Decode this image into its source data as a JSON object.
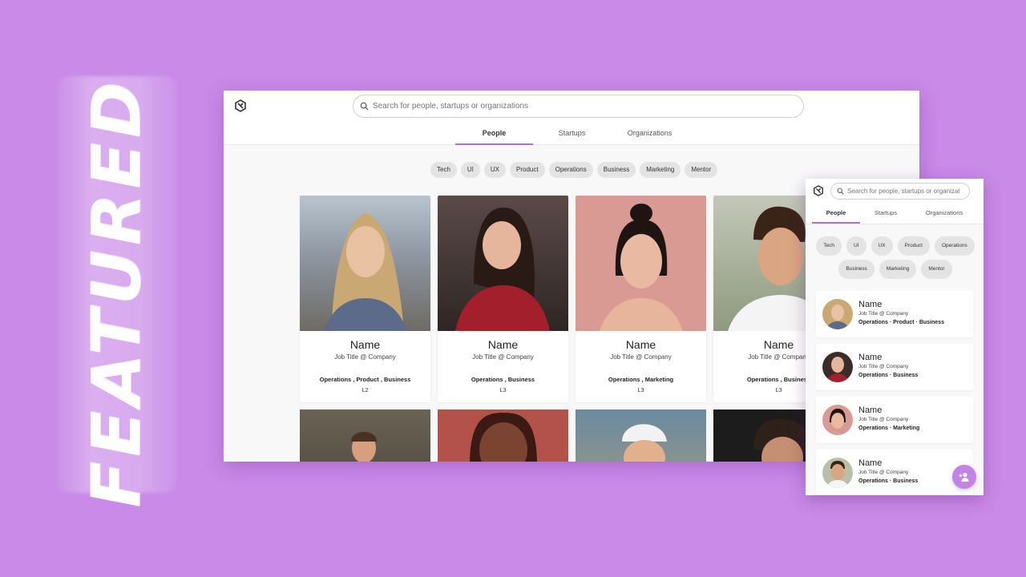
{
  "banner": {
    "text": "FEATURED"
  },
  "search": {
    "placeholder": "Search for people, startups or organizations"
  },
  "tabs": [
    {
      "label": "People",
      "active": true
    },
    {
      "label": "Startups",
      "active": false
    },
    {
      "label": "Organizations",
      "active": false
    }
  ],
  "filters": [
    "Tech",
    "UI",
    "UX",
    "Product",
    "Operations",
    "Business",
    "Marketing",
    "Mentor"
  ],
  "people": [
    {
      "name": "Name",
      "job": "Job Title @ Company",
      "tags": "Operations , Product , Business",
      "level": "L2",
      "mobile_tags": "Operations · Product · Business"
    },
    {
      "name": "Name",
      "job": "Job Title @ Company",
      "tags": "Operations , Business",
      "level": "L3",
      "mobile_tags": "Operations · Business"
    },
    {
      "name": "Name",
      "job": "Job Title @ Company",
      "tags": "Operations , Marketing",
      "level": "L3",
      "mobile_tags": "Operations · Marketing"
    },
    {
      "name": "Name",
      "job": "Job Title @ Company",
      "tags": "Operations , Business",
      "level": "L3",
      "mobile_tags": "Operations · Business"
    }
  ],
  "colors": {
    "background": "#c98ae8",
    "accent": "#b36fd9",
    "fab": "#c282e6"
  },
  "icons": {
    "logo": "app-logo-icon",
    "search": "search-icon",
    "fab": "add-person-icon"
  }
}
